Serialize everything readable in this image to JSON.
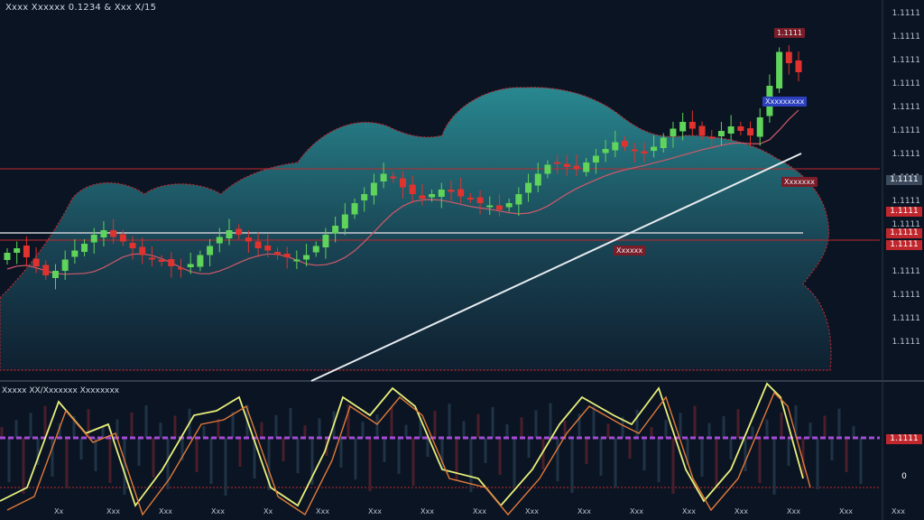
{
  "header": {
    "symbol_info": "Xxxx Xxxxxx 0.1234 & Xxx X/15"
  },
  "oscillator": {
    "title": "Xxxxx XX/Xxxxxxx Xxxxxxxx"
  },
  "price_axis": {
    "labels": [
      "1.1111",
      "1.1111",
      "1.1111",
      "1.1111",
      "1.1111",
      "1.1111",
      "1.1111",
      "1.1111",
      "1.1111",
      "1.1111",
      "1.1111",
      "1.1111",
      "1.1111",
      "1.1111",
      "1.1111"
    ],
    "tags": [
      {
        "text": "1.1111",
        "color": "#3a4a5c"
      },
      {
        "text": "1.1111",
        "color": "#c0272d"
      },
      {
        "text": "1.1111",
        "color": "#c0272d"
      },
      {
        "text": "1.1111",
        "color": "#c0272d"
      }
    ],
    "osc_tags": [
      {
        "text": "1.1111",
        "color": "#c0272d"
      },
      {
        "text": "0",
        "color": "#0b1422"
      }
    ]
  },
  "chart_tags": [
    {
      "text": "1.1111",
      "color": "#7a1d28"
    },
    {
      "text": "Xxxxxxxxx",
      "color": "#2b3fbf"
    },
    {
      "text": "Xxxxxxx",
      "color": "#7a1d28"
    },
    {
      "text": "Xxxxxx",
      "color": "#7a1d28"
    }
  ],
  "time_axis": {
    "labels": [
      "Xx",
      "Xxx",
      "Xxx",
      "Xxx",
      "Xx",
      "Xxx",
      "Xxx",
      "Xxx",
      "Xxx",
      "Xxx",
      "Xxx",
      "Xxx",
      "Xxx",
      "Xxx",
      "Xxx",
      "Xxx",
      "Xxx"
    ]
  },
  "colors": {
    "bull": "#5fd35a",
    "bear": "#e0322f",
    "cloud_top": "#2a8e96",
    "cloud_bottom": "#0f2233",
    "osc_line": "#e8f07a",
    "osc_line2": "#e07a3a",
    "signal": "#a34bd6"
  },
  "chart_data": {
    "type": "candlestick",
    "close_series": [
      96,
      98,
      94,
      90,
      86,
      88,
      93,
      97,
      100,
      104,
      106,
      103,
      101,
      98,
      95,
      93,
      92,
      90,
      89,
      91,
      95,
      99,
      103,
      106,
      104,
      101,
      98,
      97,
      95,
      94,
      93,
      95,
      99,
      104,
      108,
      113,
      118,
      122,
      127,
      131,
      129,
      125,
      122,
      120,
      122,
      124,
      123,
      121,
      120,
      118,
      117,
      115,
      118,
      122,
      127,
      131,
      135,
      136,
      134,
      133,
      136,
      139,
      142,
      145,
      143,
      141,
      140,
      143,
      147,
      151,
      154,
      151,
      148,
      147,
      150,
      152,
      150,
      148,
      156,
      170,
      185,
      180,
      176
    ]
  }
}
